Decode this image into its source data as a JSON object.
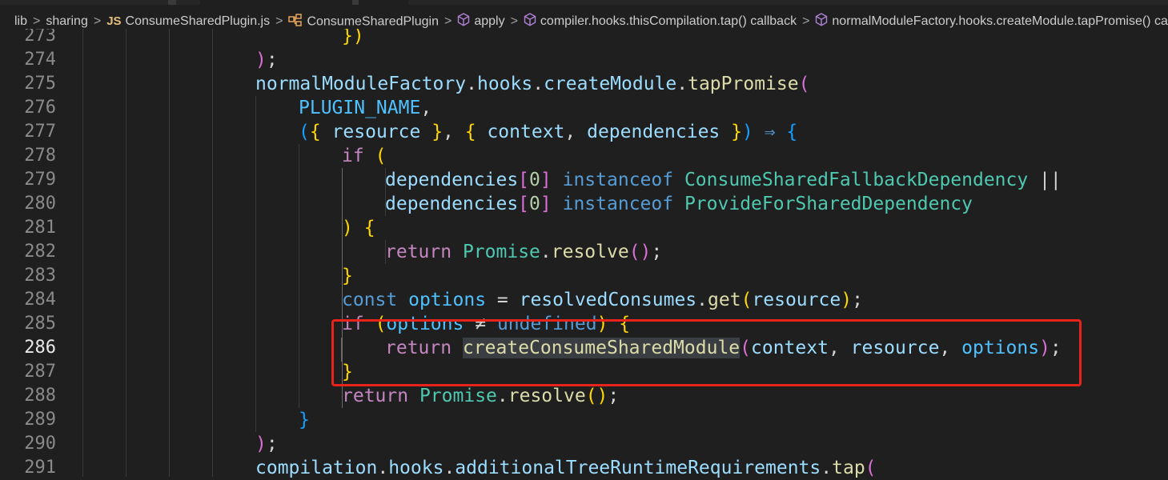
{
  "breadcrumb": {
    "items": [
      {
        "label": "lib",
        "icon": ""
      },
      {
        "label": "sharing",
        "icon": ""
      },
      {
        "label": "ConsumeSharedPlugin.js",
        "icon": "js-file-icon",
        "badge": "JS"
      },
      {
        "label": "ConsumeSharedPlugin",
        "icon": "class-symbol-icon"
      },
      {
        "label": "apply",
        "icon": "method-symbol-icon"
      },
      {
        "label": "compiler.hooks.thisCompilation.tap() callback",
        "icon": "method-symbol-icon"
      },
      {
        "label": "normalModuleFactory.hooks.createModule.tapPromise() cal",
        "icon": "method-symbol-icon"
      }
    ],
    "separator": ">"
  },
  "editor": {
    "active_line": 286,
    "highlight_color": "#e8231c",
    "lines": [
      {
        "n": "273",
        "tokens": [
          [
            "t-b1",
            "})"
          ]
        ]
      },
      {
        "n": "274",
        "tokens": [
          [
            "t-b2",
            ")"
          ],
          [
            "t-plain",
            ";"
          ]
        ]
      },
      {
        "n": "275",
        "tokens": [
          [
            "t-var",
            "normalModuleFactory"
          ],
          [
            "t-plain",
            "."
          ],
          [
            "t-var",
            "hooks"
          ],
          [
            "t-plain",
            "."
          ],
          [
            "t-var",
            "createModule"
          ],
          [
            "t-plain",
            "."
          ],
          [
            "t-func",
            "tapPromise"
          ],
          [
            "t-b2",
            "("
          ]
        ]
      },
      {
        "n": "276",
        "tokens": [
          [
            "t-const",
            "PLUGIN_NAME"
          ],
          [
            "t-plain",
            ","
          ]
        ]
      },
      {
        "n": "277",
        "tokens": [
          [
            "t-b3",
            "("
          ],
          [
            "t-b1",
            "{ "
          ],
          [
            "t-var",
            "resource"
          ],
          [
            "t-b1",
            " }"
          ],
          [
            "t-plain",
            ", "
          ],
          [
            "t-b1",
            "{ "
          ],
          [
            "t-var",
            "context"
          ],
          [
            "t-plain",
            ", "
          ],
          [
            "t-var",
            "dependencies"
          ],
          [
            "t-b1",
            " }"
          ],
          [
            "t-b3",
            ")"
          ],
          [
            "t-plain",
            " "
          ],
          [
            "t-key",
            "⇒"
          ],
          [
            "t-plain",
            " "
          ],
          [
            "t-b3",
            "{"
          ]
        ]
      },
      {
        "n": "278",
        "tokens": [
          [
            "t-ctrl",
            "if"
          ],
          [
            "t-plain",
            " "
          ],
          [
            "t-b1",
            "("
          ]
        ]
      },
      {
        "n": "279",
        "tokens": [
          [
            "t-var",
            "dependencies"
          ],
          [
            "t-b2",
            "["
          ],
          [
            "t-num",
            "0"
          ],
          [
            "t-b2",
            "]"
          ],
          [
            "t-plain",
            " "
          ],
          [
            "t-key",
            "instanceof"
          ],
          [
            "t-plain",
            " "
          ],
          [
            "t-cls",
            "ConsumeSharedFallbackDependency"
          ],
          [
            "t-plain",
            " ||"
          ]
        ]
      },
      {
        "n": "280",
        "tokens": [
          [
            "t-var",
            "dependencies"
          ],
          [
            "t-b2",
            "["
          ],
          [
            "t-num",
            "0"
          ],
          [
            "t-b2",
            "]"
          ],
          [
            "t-plain",
            " "
          ],
          [
            "t-key",
            "instanceof"
          ],
          [
            "t-plain",
            " "
          ],
          [
            "t-cls",
            "ProvideForSharedDependency"
          ]
        ]
      },
      {
        "n": "281",
        "tokens": [
          [
            "t-b1",
            ")"
          ],
          [
            "t-plain",
            " "
          ],
          [
            "t-b1",
            "{"
          ]
        ]
      },
      {
        "n": "282",
        "tokens": [
          [
            "t-ctrl",
            "return"
          ],
          [
            "t-plain",
            " "
          ],
          [
            "t-cls",
            "Promise"
          ],
          [
            "t-plain",
            "."
          ],
          [
            "t-func",
            "resolve"
          ],
          [
            "t-b2",
            "()"
          ],
          [
            "t-plain",
            ";"
          ]
        ]
      },
      {
        "n": "283",
        "tokens": [
          [
            "t-b1",
            "}"
          ]
        ]
      },
      {
        "n": "284",
        "tokens": [
          [
            "t-key",
            "const"
          ],
          [
            "t-plain",
            " "
          ],
          [
            "t-const",
            "options"
          ],
          [
            "t-plain",
            " = "
          ],
          [
            "t-var",
            "resolvedConsumes"
          ],
          [
            "t-plain",
            "."
          ],
          [
            "t-func",
            "get"
          ],
          [
            "t-b1",
            "("
          ],
          [
            "t-var",
            "resource"
          ],
          [
            "t-b1",
            ")"
          ],
          [
            "t-plain",
            ";"
          ]
        ]
      },
      {
        "n": "285",
        "tokens": [
          [
            "t-ctrl",
            "if"
          ],
          [
            "t-plain",
            " "
          ],
          [
            "t-b1",
            "("
          ],
          [
            "t-const",
            "options"
          ],
          [
            "t-plain",
            " "
          ],
          [
            "t-op",
            "≠"
          ],
          [
            "t-plain",
            " "
          ],
          [
            "t-key",
            "undefined"
          ],
          [
            "t-b1",
            ")"
          ],
          [
            "t-plain",
            " "
          ],
          [
            "t-b1",
            "{"
          ]
        ]
      },
      {
        "n": "286",
        "tokens": [
          [
            "t-ctrl",
            "return"
          ],
          [
            "t-plain",
            " "
          ],
          [
            "t-func hl-word",
            "createConsumeSharedModule"
          ],
          [
            "t-b2",
            "("
          ],
          [
            "t-var",
            "context"
          ],
          [
            "t-plain",
            ", "
          ],
          [
            "t-var",
            "resource"
          ],
          [
            "t-plain",
            ", "
          ],
          [
            "t-const",
            "options"
          ],
          [
            "t-b2",
            ")"
          ],
          [
            "t-plain",
            ";"
          ]
        ]
      },
      {
        "n": "287",
        "tokens": [
          [
            "t-b1",
            "}"
          ]
        ]
      },
      {
        "n": "288",
        "tokens": [
          [
            "t-ctrl",
            "return"
          ],
          [
            "t-plain",
            " "
          ],
          [
            "t-cls",
            "Promise"
          ],
          [
            "t-plain",
            "."
          ],
          [
            "t-func",
            "resolve"
          ],
          [
            "t-b1",
            "()"
          ],
          [
            "t-plain",
            ";"
          ]
        ]
      },
      {
        "n": "289",
        "tokens": [
          [
            "t-b3",
            "}"
          ]
        ]
      },
      {
        "n": "290",
        "tokens": [
          [
            "t-b2",
            ")"
          ],
          [
            "t-plain",
            ";"
          ]
        ]
      },
      {
        "n": "291",
        "tokens": [
          [
            "t-var",
            "compilation"
          ],
          [
            "t-plain",
            "."
          ],
          [
            "t-var",
            "hooks"
          ],
          [
            "t-plain",
            "."
          ],
          [
            "t-var",
            "additionalTreeRuntimeRequirements"
          ],
          [
            "t-plain",
            "."
          ],
          [
            "t-func",
            "tap"
          ],
          [
            "t-b2",
            "("
          ]
        ]
      }
    ]
  }
}
